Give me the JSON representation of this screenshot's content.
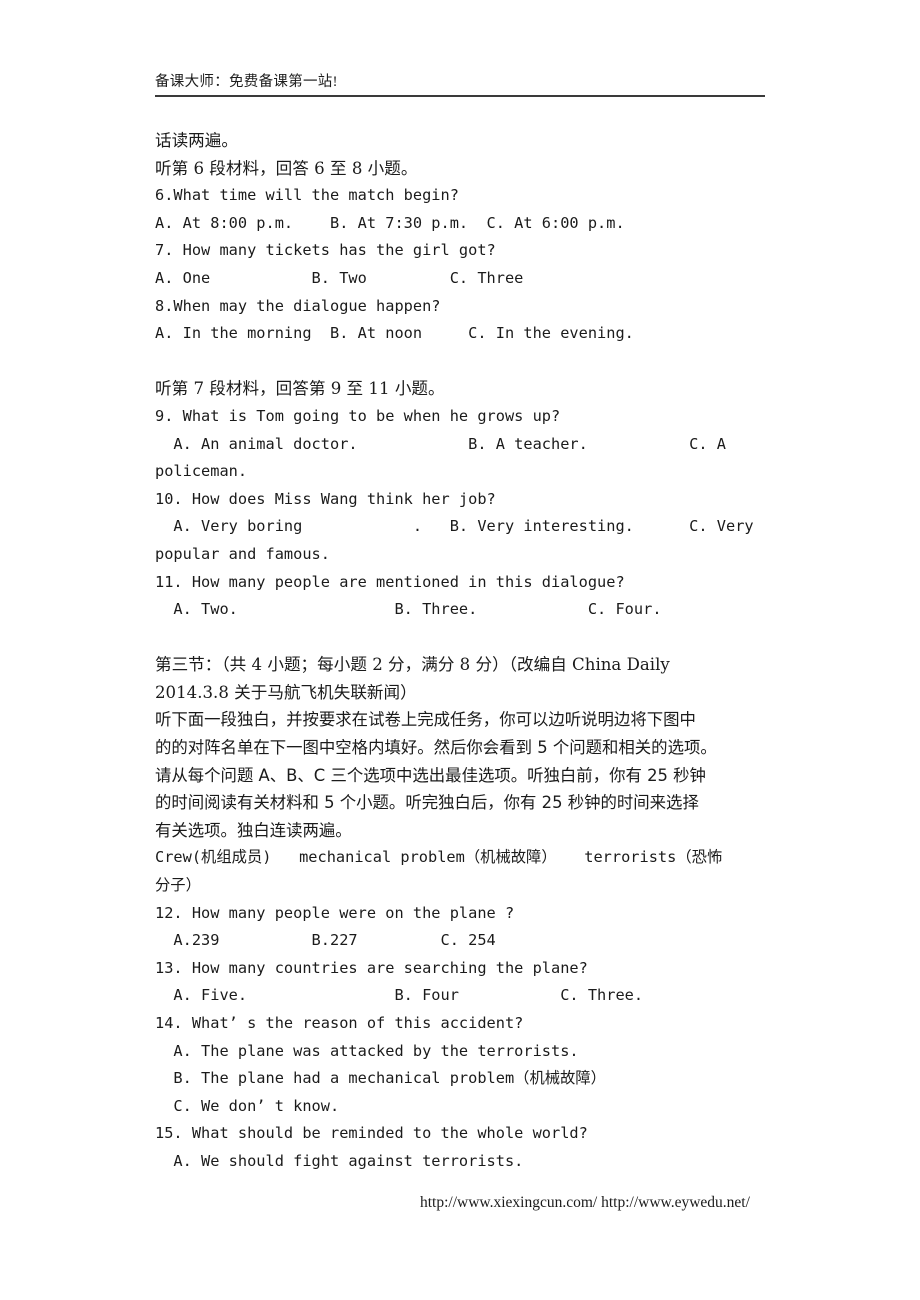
{
  "header": {
    "site_banner": "备课大师：免费备课第一站!"
  },
  "body": {
    "lines": [
      {
        "id": "l01",
        "style": "cn",
        "text": "话读两遍。"
      },
      {
        "id": "l02",
        "style": "cn",
        "text": "听第 6 段材料，回答 6 至 8 小题。"
      },
      {
        "id": "l03",
        "style": "mono",
        "text": "6.What time will the match begin?"
      },
      {
        "id": "l04",
        "style": "mono",
        "text": "A. At 8:00 p.m.    B. At 7:30 p.m.  C. At 6:00 p.m."
      },
      {
        "id": "l05",
        "style": "mono",
        "text": "7. How many tickets has the girl got?"
      },
      {
        "id": "l06",
        "style": "mono",
        "text": "A. One           B. Two         C. Three"
      },
      {
        "id": "l07",
        "style": "mono",
        "text": "8.When may the dialogue happen?"
      },
      {
        "id": "l08",
        "style": "mono",
        "text": "A. In the morning  B. At noon     C. In the evening."
      },
      {
        "id": "l09",
        "style": "blank",
        "text": ""
      },
      {
        "id": "l10",
        "style": "cn",
        "text": "听第 7 段材料，回答第 9 至 11 小题。"
      },
      {
        "id": "l11",
        "style": "mono",
        "text": "9. What is Tom going to be when he grows up?"
      },
      {
        "id": "l12",
        "style": "mono",
        "text": "  A. An animal doctor.            B. A teacher.           C. A"
      },
      {
        "id": "l13",
        "style": "mono",
        "text": "policeman."
      },
      {
        "id": "l14",
        "style": "mono",
        "text": "10. How does Miss Wang think her job?"
      },
      {
        "id": "l15",
        "style": "mono",
        "text": "  A. Very boring            .   B. Very interesting.      C. Very"
      },
      {
        "id": "l16",
        "style": "mono",
        "text": "popular and famous."
      },
      {
        "id": "l17",
        "style": "mono",
        "text": "11. How many people are mentioned in this dialogue?"
      },
      {
        "id": "l18",
        "style": "mono",
        "text": "  A. Two.                 B. Three.            C. Four."
      },
      {
        "id": "l19",
        "style": "blank",
        "text": ""
      },
      {
        "id": "l20",
        "style": "cn",
        "text": "第三节：（共 4 小题；每小题 2 分，满分 8 分）（改编自 China Daily"
      },
      {
        "id": "l21",
        "style": "cn",
        "text": "2014.3.8 关于马航飞机失联新闻）"
      },
      {
        "id": "l22",
        "style": "cnpara",
        "text": "听下面一段独白，并按要求在试卷上完成任务，你可以边听说明边将下图中"
      },
      {
        "id": "l23",
        "style": "cnpara",
        "text": "的的对阵名单在下一图中空格内填好。然后你会看到 5 个问题和相关的选项。"
      },
      {
        "id": "l24",
        "style": "cnpara",
        "text": "请从每个问题 A、B、C 三个选项中选出最佳选项。听独白前，你有 25 秒钟"
      },
      {
        "id": "l25",
        "style": "cnpara",
        "text": "的时间阅读有关材料和 5 个小题。听完独白后，你有 25 秒钟的时间来选择"
      },
      {
        "id": "l26",
        "style": "cnpara",
        "text": "有关选项。独白连读两遍。"
      },
      {
        "id": "l27",
        "style": "mono",
        "text": "Crew(机组成员)   mechanical problem（机械故障）   terrorists（恐怖"
      },
      {
        "id": "l28",
        "style": "mono",
        "text": "分子）"
      },
      {
        "id": "l29",
        "style": "mono",
        "text": "12. How many people were on the plane ?"
      },
      {
        "id": "l30",
        "style": "mono",
        "text": "  A.239          B.227         C. 254"
      },
      {
        "id": "l31",
        "style": "mono",
        "text": "13. How many countries are searching the plane?"
      },
      {
        "id": "l32",
        "style": "mono",
        "text": "  A. Five.                B. Four           C. Three."
      },
      {
        "id": "l33",
        "style": "mono",
        "text": "14. What’ s the reason of this accident?"
      },
      {
        "id": "l34",
        "style": "mono",
        "text": "  A. The plane was attacked by the terrorists."
      },
      {
        "id": "l35",
        "style": "mono",
        "text": "  B. The plane had a mechanical problem（机械故障）"
      },
      {
        "id": "l36",
        "style": "mono",
        "text": "  C. We don’ t know."
      },
      {
        "id": "l37",
        "style": "mono",
        "text": "15. What should be reminded to the whole world?"
      },
      {
        "id": "l38",
        "style": "mono",
        "text": "  A. We should fight against terrorists."
      }
    ]
  },
  "footer": {
    "urls": "http://www.xiexingcun.com/ http://www.eywedu.net/"
  }
}
